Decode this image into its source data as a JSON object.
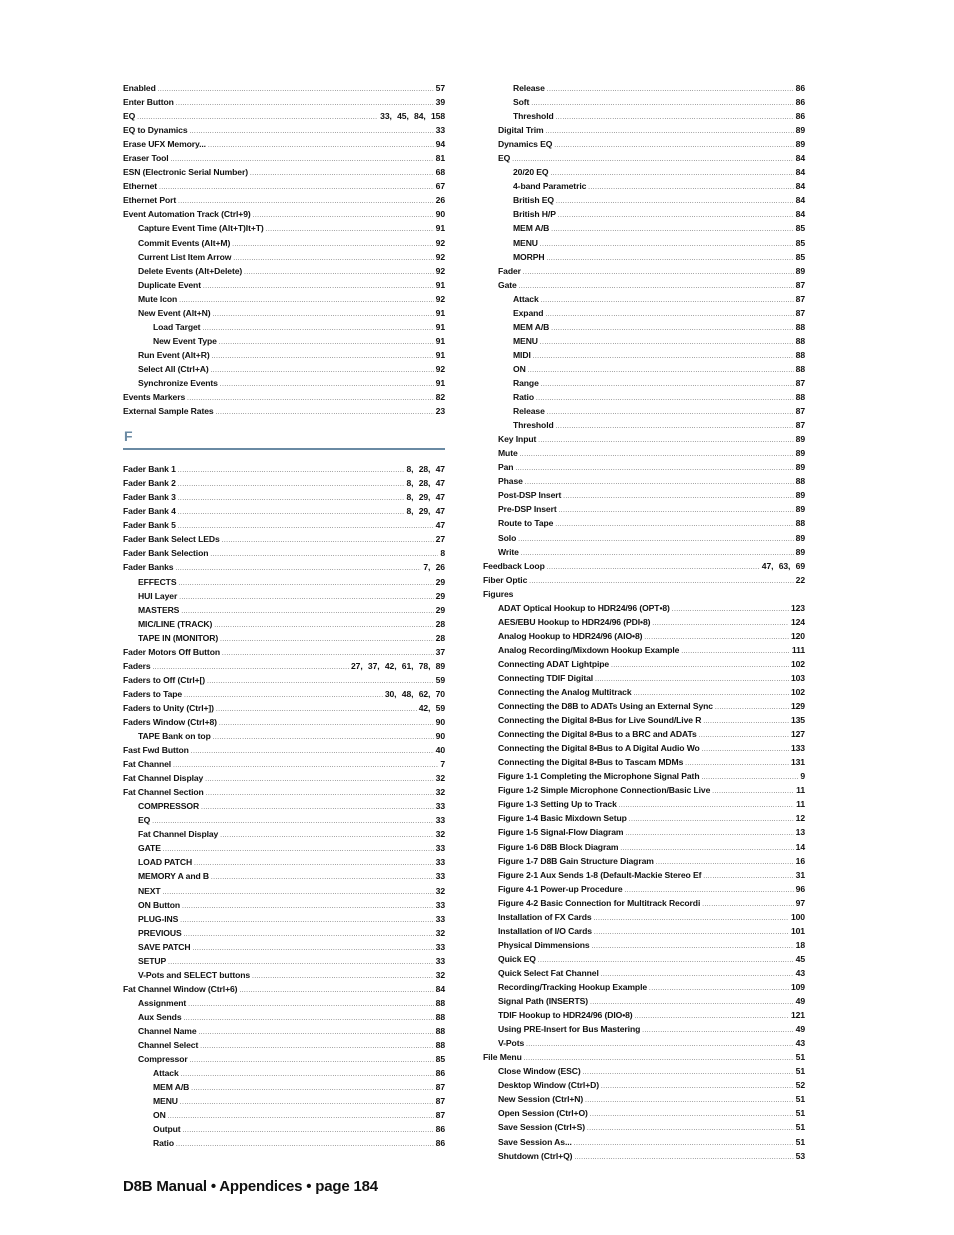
{
  "footer": "D8B Manual • Appendices • page  184",
  "section_f": {
    "letter": "F",
    "accent_color": "#6a8aa3"
  },
  "left_before": [
    {
      "label": "Enabled",
      "pages": "57",
      "level": 0
    },
    {
      "label": "Enter Button",
      "pages": "39",
      "level": 0
    },
    {
      "label": "EQ",
      "pages": "33,  45,  84,  158",
      "level": 0
    },
    {
      "label": "EQ to Dynamics",
      "pages": "33",
      "level": 0
    },
    {
      "label": "Erase UFX Memory...",
      "pages": "94",
      "level": 0
    },
    {
      "label": "Eraser Tool",
      "pages": "81",
      "level": 0
    },
    {
      "label": "ESN (Electronic Serial Number)",
      "pages": "68",
      "level": 0
    },
    {
      "label": "Ethernet",
      "pages": "67",
      "level": 0
    },
    {
      "label": "Ethernet Port",
      "pages": "26",
      "level": 0
    },
    {
      "label": "Event Automation Track (Ctrl+9)",
      "pages": "90",
      "level": 0
    },
    {
      "label": "Capture Event Time (Alt+T)lt+T)",
      "pages": "91",
      "level": 1
    },
    {
      "label": "Commit Events (Alt+M)",
      "pages": "92",
      "level": 1
    },
    {
      "label": "Current List Item Arrow",
      "pages": "92",
      "level": 1
    },
    {
      "label": "Delete Events (Alt+Delete)",
      "pages": "92",
      "level": 1
    },
    {
      "label": "Duplicate Event",
      "pages": "91",
      "level": 1
    },
    {
      "label": "Mute Icon",
      "pages": "92",
      "level": 1
    },
    {
      "label": "New Event (Alt+N)",
      "pages": "91",
      "level": 1
    },
    {
      "label": "Load Target",
      "pages": "91",
      "level": 2
    },
    {
      "label": "New Event Type",
      "pages": "91",
      "level": 2
    },
    {
      "label": "Run Event (Alt+R)",
      "pages": "91",
      "level": 1
    },
    {
      "label": "Select All (Ctrl+A)",
      "pages": "92",
      "level": 1
    },
    {
      "label": "Synchronize Events",
      "pages": "91",
      "level": 1
    },
    {
      "label": "Events Markers",
      "pages": "82",
      "level": 0
    },
    {
      "label": "External Sample Rates",
      "pages": "23",
      "level": 0
    }
  ],
  "left_after": [
    {
      "label": "Fader Bank 1",
      "pages": "8,  28,  47",
      "level": 0
    },
    {
      "label": "Fader Bank 2",
      "pages": "8,  28,  47",
      "level": 0
    },
    {
      "label": "Fader Bank 3",
      "pages": "8,  29,  47",
      "level": 0
    },
    {
      "label": "Fader Bank 4",
      "pages": "8,  29,  47",
      "level": 0
    },
    {
      "label": "Fader Bank 5",
      "pages": "47",
      "level": 0
    },
    {
      "label": "Fader Bank Select LEDs",
      "pages": "27",
      "level": 0
    },
    {
      "label": "Fader Bank Selection",
      "pages": "8",
      "level": 0
    },
    {
      "label": "Fader Banks",
      "pages": "7,  26",
      "level": 0
    },
    {
      "label": "EFFECTS",
      "pages": "29",
      "level": 1
    },
    {
      "label": "HUI Layer",
      "pages": "29",
      "level": 1
    },
    {
      "label": "MASTERS",
      "pages": "29",
      "level": 1
    },
    {
      "label": "MIC/LINE (TRACK)",
      "pages": "28",
      "level": 1
    },
    {
      "label": "TAPE IN (MONITOR)",
      "pages": "28",
      "level": 1
    },
    {
      "label": "Fader Motors Off Button",
      "pages": "37",
      "level": 0
    },
    {
      "label": "Faders",
      "pages": "27,  37,  42,  61,  78,  89",
      "level": 0
    },
    {
      "label": "Faders to Off (Ctrl+[)",
      "pages": "59",
      "level": 0
    },
    {
      "label": "Faders to Tape",
      "pages": "30,  48,  62,  70",
      "level": 0
    },
    {
      "label": "Faders to Unity (Ctrl+])",
      "pages": "42,  59",
      "level": 0
    },
    {
      "label": "Faders Window (Ctrl+8)",
      "pages": "90",
      "level": 0
    },
    {
      "label": "TAPE Bank on top",
      "pages": "90",
      "level": 1
    },
    {
      "label": "Fast Fwd Button",
      "pages": "40",
      "level": 0
    },
    {
      "label": "Fat Channel",
      "pages": "7",
      "level": 0
    },
    {
      "label": "Fat Channel Display",
      "pages": "32",
      "level": 0
    },
    {
      "label": "Fat Channel Section",
      "pages": "32",
      "level": 0
    },
    {
      "label": "COMPRESSOR",
      "pages": "33",
      "level": 1
    },
    {
      "label": "EQ",
      "pages": "33",
      "level": 1
    },
    {
      "label": "Fat Channel Display",
      "pages": "32",
      "level": 1
    },
    {
      "label": "GATE",
      "pages": "33",
      "level": 1
    },
    {
      "label": "LOAD PATCH",
      "pages": "33",
      "level": 1
    },
    {
      "label": "MEMORY A and B",
      "pages": "33",
      "level": 1
    },
    {
      "label": "NEXT",
      "pages": "32",
      "level": 1
    },
    {
      "label": "ON Button",
      "pages": "33",
      "level": 1
    },
    {
      "label": "PLUG-INS",
      "pages": "33",
      "level": 1
    },
    {
      "label": "PREVIOUS",
      "pages": "32",
      "level": 1
    },
    {
      "label": "SAVE PATCH",
      "pages": "33",
      "level": 1
    },
    {
      "label": "SETUP",
      "pages": "33",
      "level": 1
    },
    {
      "label": "V-Pots and SELECT buttons",
      "pages": "32",
      "level": 1
    },
    {
      "label": "Fat Channel Window (Ctrl+6)",
      "pages": "84",
      "level": 0
    },
    {
      "label": "Assignment",
      "pages": "88",
      "level": 1
    },
    {
      "label": "Aux Sends",
      "pages": "88",
      "level": 1
    },
    {
      "label": "Channel Name",
      "pages": "88",
      "level": 1
    },
    {
      "label": "Channel Select",
      "pages": "88",
      "level": 1
    },
    {
      "label": "Compressor",
      "pages": "85",
      "level": 1
    },
    {
      "label": "Attack",
      "pages": "86",
      "level": 2
    },
    {
      "label": "MEM A/B",
      "pages": "87",
      "level": 2
    },
    {
      "label": "MENU",
      "pages": "87",
      "level": 2
    },
    {
      "label": "ON",
      "pages": "87",
      "level": 2
    },
    {
      "label": "Output",
      "pages": "86",
      "level": 2
    },
    {
      "label": "Ratio",
      "pages": "86",
      "level": 2
    }
  ],
  "right": [
    {
      "label": "Release",
      "pages": "86",
      "level": 2
    },
    {
      "label": "Soft",
      "pages": "86",
      "level": 2
    },
    {
      "label": "Threshold",
      "pages": "86",
      "level": 2
    },
    {
      "label": "Digital Trim",
      "pages": "89",
      "level": 1
    },
    {
      "label": "Dynamics EQ",
      "pages": "89",
      "level": 1
    },
    {
      "label": "EQ",
      "pages": "84",
      "level": 1
    },
    {
      "label": "20/20 EQ",
      "pages": "84",
      "level": 2
    },
    {
      "label": "4-band Parametric",
      "pages": "84",
      "level": 2
    },
    {
      "label": "British EQ",
      "pages": "84",
      "level": 2
    },
    {
      "label": "British H/P",
      "pages": "84",
      "level": 2
    },
    {
      "label": "MEM A/B",
      "pages": "85",
      "level": 2
    },
    {
      "label": "MENU",
      "pages": "85",
      "level": 2
    },
    {
      "label": "MORPH",
      "pages": "85",
      "level": 2
    },
    {
      "label": "Fader",
      "pages": "89",
      "level": 1
    },
    {
      "label": "Gate",
      "pages": "87",
      "level": 1
    },
    {
      "label": "Attack",
      "pages": "87",
      "level": 2
    },
    {
      "label": "Expand",
      "pages": "87",
      "level": 2
    },
    {
      "label": "MEM A/B",
      "pages": "88",
      "level": 2
    },
    {
      "label": "MENU",
      "pages": "88",
      "level": 2
    },
    {
      "label": "MIDI",
      "pages": "88",
      "level": 2
    },
    {
      "label": "ON",
      "pages": "88",
      "level": 2
    },
    {
      "label": "Range",
      "pages": "87",
      "level": 2
    },
    {
      "label": "Ratio",
      "pages": "88",
      "level": 2
    },
    {
      "label": "Release",
      "pages": "87",
      "level": 2
    },
    {
      "label": "Threshold",
      "pages": "87",
      "level": 2
    },
    {
      "label": "Key Input",
      "pages": "89",
      "level": 1
    },
    {
      "label": "Mute",
      "pages": "89",
      "level": 1
    },
    {
      "label": "Pan",
      "pages": "89",
      "level": 1
    },
    {
      "label": "Phase",
      "pages": "88",
      "level": 1
    },
    {
      "label": "Post-DSP Insert",
      "pages": "89",
      "level": 1
    },
    {
      "label": "Pre-DSP Insert",
      "pages": "89",
      "level": 1
    },
    {
      "label": "Route to Tape",
      "pages": "88",
      "level": 1
    },
    {
      "label": "Solo",
      "pages": "89",
      "level": 1
    },
    {
      "label": "Write",
      "pages": "89",
      "level": 1
    },
    {
      "label": "Feedback Loop",
      "pages": "47,  63,  69",
      "level": 0
    },
    {
      "label": "Fiber Optic",
      "pages": "22",
      "level": 0
    },
    {
      "label": "Figures",
      "pages": "",
      "level": 0
    },
    {
      "label": "ADAT Optical Hookup to HDR24/96 (OPT•8)",
      "pages": "123",
      "level": 1
    },
    {
      "label": "AES/EBU Hookup to HDR24/96 (PDI•8)",
      "pages": "124",
      "level": 1
    },
    {
      "label": "Analog Hookup to HDR24/96 (AIO•8)",
      "pages": "120",
      "level": 1
    },
    {
      "label": "Analog Recording/Mixdown Hookup Example",
      "pages": "111",
      "level": 1
    },
    {
      "label": "Connecting ADAT Lightpipe",
      "pages": "102",
      "level": 1
    },
    {
      "label": "Connecting TDIF Digital",
      "pages": "103",
      "level": 1
    },
    {
      "label": "Connecting the Analog Multitrack",
      "pages": "102",
      "level": 1
    },
    {
      "label": "Connecting the D8B to ADATs Using an External Sync",
      "pages": "129",
      "level": 1
    },
    {
      "label": "Connecting the Digital 8•Bus for Live Sound/Live R",
      "pages": "135",
      "level": 1
    },
    {
      "label": "Connecting the Digital 8•Bus to a BRC and ADATs",
      "pages": "127",
      "level": 1
    },
    {
      "label": "Connecting the Digital 8•Bus to A Digital Audio Wo",
      "pages": "133",
      "level": 1
    },
    {
      "label": "Connecting the Digital 8•Bus to Tascam MDMs",
      "pages": "131",
      "level": 1
    },
    {
      "label": "Figure 1-1 Completing the Microphone Signal Path",
      "pages": "9",
      "level": 1
    },
    {
      "label": "Figure 1-2 Simple Microphone Connection/Basic Live",
      "pages": "11",
      "level": 1
    },
    {
      "label": "Figure 1-3 Setting Up to Track",
      "pages": "11",
      "level": 1
    },
    {
      "label": "Figure 1-4 Basic Mixdown Setup",
      "pages": "12",
      "level": 1
    },
    {
      "label": "Figure 1-5 Signal-Flow Diagram",
      "pages": "13",
      "level": 1
    },
    {
      "label": "Figure 1-6 D8B Block Diagram",
      "pages": "14",
      "level": 1
    },
    {
      "label": "Figure 1-7 D8B Gain Structure Diagram",
      "pages": "16",
      "level": 1
    },
    {
      "label": "Figure 2-1 Aux Sends 1-8 (Default-Mackie Stereo Ef",
      "pages": "31",
      "level": 1
    },
    {
      "label": "Figure 4-1 Power-up Procedure",
      "pages": "96",
      "level": 1
    },
    {
      "label": "Figure 4-2 Basic Connection for Multitrack Recordi",
      "pages": "97",
      "level": 1
    },
    {
      "label": "Installation of FX Cards",
      "pages": "100",
      "level": 1
    },
    {
      "label": "Installation of I/O Cards",
      "pages": "101",
      "level": 1
    },
    {
      "label": "Physical Dimmensions",
      "pages": "18",
      "level": 1
    },
    {
      "label": "Quick EQ",
      "pages": "45",
      "level": 1
    },
    {
      "label": "Quick Select Fat Channel",
      "pages": "43",
      "level": 1
    },
    {
      "label": "Recording/Tracking Hookup Example",
      "pages": "109",
      "level": 1
    },
    {
      "label": "Signal Path (INSERTS)",
      "pages": "49",
      "level": 1
    },
    {
      "label": "TDIF Hookup to HDR24/96 (DIO•8)",
      "pages": "121",
      "level": 1
    },
    {
      "label": "Using PRE-Insert for Bus Mastering",
      "pages": "49",
      "level": 1
    },
    {
      "label": "V-Pots",
      "pages": "43",
      "level": 1
    },
    {
      "label": "File Menu",
      "pages": "51",
      "level": 0
    },
    {
      "label": "Close Window (ESC)",
      "pages": "51",
      "level": 1
    },
    {
      "label": "Desktop Window (Ctrl+D)",
      "pages": "52",
      "level": 1
    },
    {
      "label": "New Session (Ctrl+N)",
      "pages": "51",
      "level": 1
    },
    {
      "label": "Open Session (Ctrl+O)",
      "pages": "51",
      "level": 1
    },
    {
      "label": "Save Session (Ctrl+S)",
      "pages": "51",
      "level": 1
    },
    {
      "label": "Save Session As...",
      "pages": "51",
      "level": 1
    },
    {
      "label": "Shutdown (Ctrl+Q)",
      "pages": "53",
      "level": 1
    }
  ]
}
